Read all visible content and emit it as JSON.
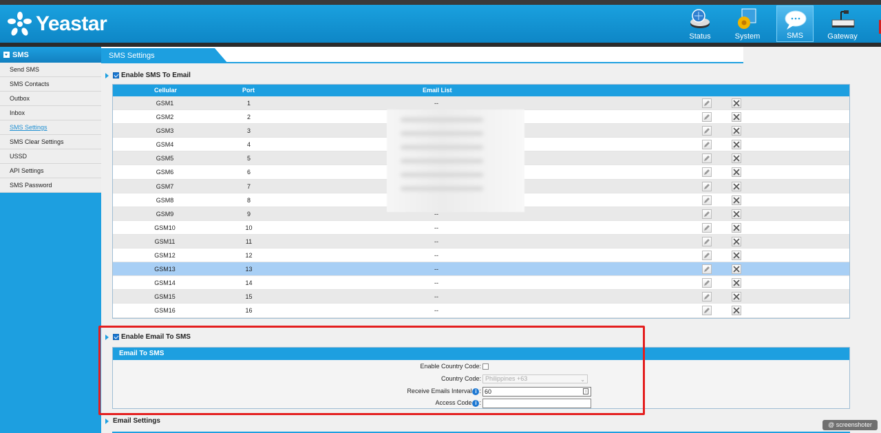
{
  "app": {
    "brand": "Yeastar",
    "accent": "#1d9fe0"
  },
  "nav": [
    {
      "label": "Status",
      "icon": "status-icon",
      "active": false
    },
    {
      "label": "System",
      "icon": "system-icon",
      "active": false
    },
    {
      "label": "SMS",
      "icon": "sms-icon",
      "active": true
    },
    {
      "label": "Gateway",
      "icon": "gateway-icon",
      "active": false
    }
  ],
  "sidebar": {
    "title": "SMS",
    "items": [
      {
        "label": "Send SMS"
      },
      {
        "label": "SMS Contacts"
      },
      {
        "label": "Outbox"
      },
      {
        "label": "Inbox"
      },
      {
        "label": "SMS Settings",
        "active": true
      },
      {
        "label": "SMS Clear Settings"
      },
      {
        "label": "USSD"
      },
      {
        "label": "API Settings"
      },
      {
        "label": "SMS Password"
      }
    ]
  },
  "page": {
    "tab": "SMS Settings",
    "sms_to_email": {
      "title": "Enable SMS To Email",
      "checked": true,
      "columns": {
        "cellular": "Cellular",
        "port": "Port",
        "email": "Email List"
      },
      "rows": [
        {
          "cellular": "GSM1",
          "port": "1",
          "email": "--"
        },
        {
          "cellular": "GSM2",
          "port": "2",
          "email": ""
        },
        {
          "cellular": "GSM3",
          "port": "3",
          "email": ""
        },
        {
          "cellular": "GSM4",
          "port": "4",
          "email": ""
        },
        {
          "cellular": "GSM5",
          "port": "5",
          "email": ""
        },
        {
          "cellular": "GSM6",
          "port": "6",
          "email": ""
        },
        {
          "cellular": "GSM7",
          "port": "7",
          "email": ""
        },
        {
          "cellular": "GSM8",
          "port": "8",
          "email": ""
        },
        {
          "cellular": "GSM9",
          "port": "9",
          "email": "--"
        },
        {
          "cellular": "GSM10",
          "port": "10",
          "email": "--"
        },
        {
          "cellular": "GSM11",
          "port": "11",
          "email": "--"
        },
        {
          "cellular": "GSM12",
          "port": "12",
          "email": "--"
        },
        {
          "cellular": "GSM13",
          "port": "13",
          "email": "--",
          "selected": true
        },
        {
          "cellular": "GSM14",
          "port": "14",
          "email": "--"
        },
        {
          "cellular": "GSM15",
          "port": "15",
          "email": "--"
        },
        {
          "cellular": "GSM16",
          "port": "16",
          "email": "--"
        }
      ]
    },
    "email_to_sms": {
      "title": "Enable Email To SMS",
      "checked": true,
      "box_title": "Email To SMS",
      "enable_country_code_label": "Enable Country Code:",
      "country_code_label": "Country Code:",
      "country_code_value": "Philippines +63",
      "interval_label": "Receive Emails Interval",
      "interval_value": "60",
      "access_code_label": "Access Code",
      "access_code_value": "",
      "colon": ":"
    },
    "email_settings": {
      "title": "Email Settings"
    }
  },
  "watermark": "@ screenshoter"
}
